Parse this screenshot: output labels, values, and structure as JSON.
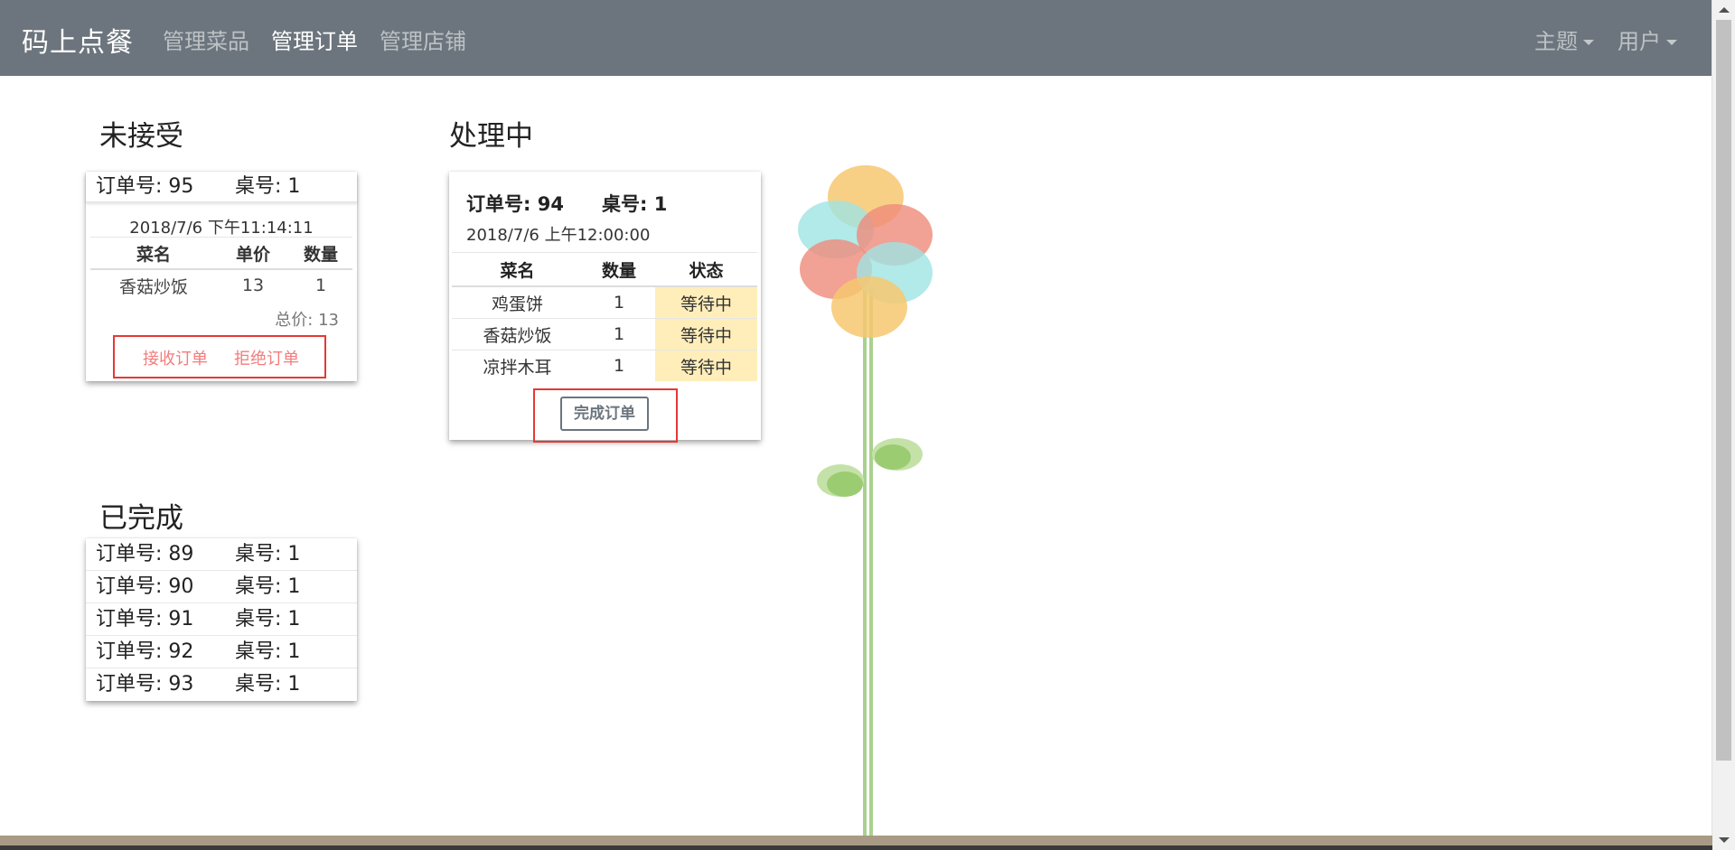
{
  "nav": {
    "brand": "码上点餐",
    "links": [
      "管理菜品",
      "管理订单",
      "管理店铺"
    ],
    "right": [
      "主题",
      "用户"
    ]
  },
  "pending": {
    "title": "未接受",
    "order_label": "订单号: 95",
    "table_label": "桌号: 1",
    "time": "2018/7/6 下午11:14:11",
    "headers": [
      "菜名",
      "单价",
      "数量"
    ],
    "rows": [
      [
        "香菇炒饭",
        "13",
        "1"
      ]
    ],
    "total": "总价: 13",
    "accept": "接收订单",
    "reject": "拒绝订单"
  },
  "processing": {
    "title": "处理中",
    "order_label": "订单号: 94",
    "table_label": "桌号: 1",
    "time": "2018/7/6 上午12:00:00",
    "headers": [
      "菜名",
      "数量",
      "状态"
    ],
    "rows": [
      [
        "鸡蛋饼",
        "1",
        "等待中"
      ],
      [
        "香菇炒饭",
        "1",
        "等待中"
      ],
      [
        "凉拌木耳",
        "1",
        "等待中"
      ]
    ],
    "complete": "完成订单"
  },
  "completed": {
    "title": "已完成",
    "orders": [
      {
        "order": "订单号: 89",
        "table": "桌号: 1"
      },
      {
        "order": "订单号: 90",
        "table": "桌号: 1"
      },
      {
        "order": "订单号: 91",
        "table": "桌号: 1"
      },
      {
        "order": "订单号: 92",
        "table": "桌号: 1"
      },
      {
        "order": "订单号: 93",
        "table": "桌号: 1"
      }
    ]
  },
  "colors": {
    "navbar": "#6c757d",
    "status_bg": "#ffeeba",
    "highlight_box": "#e53935",
    "action_link": "#f57c7c"
  }
}
